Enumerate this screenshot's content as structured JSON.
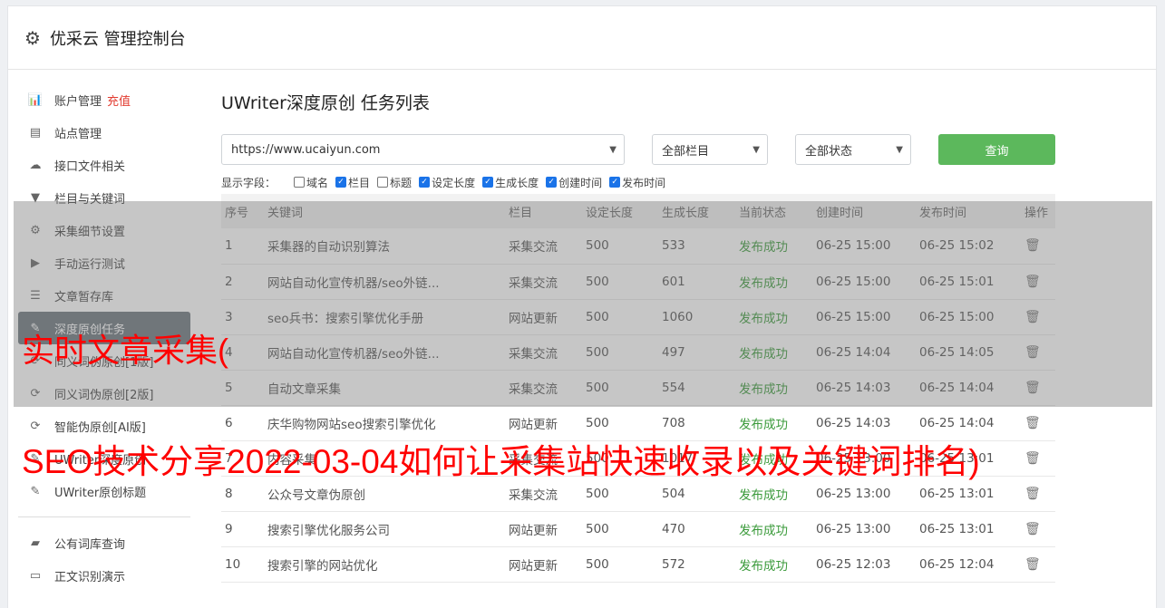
{
  "header": {
    "title": "优采云 管理控制台",
    "icon": "gear-icon"
  },
  "sidebar": {
    "items": [
      {
        "label": "账户管理",
        "badge": "充值",
        "icon": "bar-chart-icon",
        "glyph": "📊"
      },
      {
        "label": "站点管理",
        "icon": "server-icon",
        "glyph": "▤"
      },
      {
        "label": "接口文件相关",
        "icon": "cloud-upload-icon",
        "glyph": "☁"
      },
      {
        "label": "栏目与关键词",
        "icon": "filter-icon",
        "glyph": "▼"
      },
      {
        "label": "采集细节设置",
        "icon": "cogs-icon",
        "glyph": "⚙"
      },
      {
        "label": "手动运行测试",
        "icon": "play-circle-icon",
        "glyph": "▶"
      },
      {
        "label": "文章暂存库",
        "icon": "database-icon",
        "glyph": "☰"
      },
      {
        "label": "深度原创任务",
        "icon": "edit-icon",
        "glyph": "✎",
        "active": true
      },
      {
        "label": "同义词伪原创[1版]",
        "icon": "refresh-icon",
        "glyph": "⟳"
      },
      {
        "label": "同义词伪原创[2版]",
        "icon": "refresh-icon",
        "glyph": "⟳"
      },
      {
        "label": "智能伪原创[AI版]",
        "icon": "refresh-icon",
        "glyph": "⟳"
      },
      {
        "label": "UWriter深度原创",
        "icon": "edit-icon",
        "glyph": "✎"
      },
      {
        "label": "UWriter原创标题",
        "icon": "edit-icon",
        "glyph": "✎"
      }
    ],
    "items2": [
      {
        "label": "公有词库查询",
        "icon": "book-icon",
        "glyph": "▰"
      },
      {
        "label": "正文识别演示",
        "icon": "desktop-icon",
        "glyph": "▭"
      }
    ]
  },
  "main": {
    "title": "UWriter深度原创 任务列表",
    "site_select": "https://www.ucaiyun.com",
    "category_select": "全部栏目",
    "status_select": "全部状态",
    "query_label": "查询",
    "fields_label": "显示字段：",
    "fields": [
      {
        "label": "域名",
        "checked": false
      },
      {
        "label": "栏目",
        "checked": true
      },
      {
        "label": "标题",
        "checked": false
      },
      {
        "label": "设定长度",
        "checked": true
      },
      {
        "label": "生成长度",
        "checked": true
      },
      {
        "label": "创建时间",
        "checked": true
      },
      {
        "label": "发布时间",
        "checked": true
      }
    ],
    "columns": [
      "序号",
      "关键词",
      "栏目",
      "设定长度",
      "生成长度",
      "当前状态",
      "创建时间",
      "发布时间",
      "操作"
    ],
    "rows": [
      [
        "1",
        "采集器的自动识别算法",
        "采集交流",
        "500",
        "533",
        "发布成功",
        "06-25 15:00",
        "06-25 15:02"
      ],
      [
        "2",
        "网站自动化宣传机器/seo外链...",
        "采集交流",
        "500",
        "601",
        "发布成功",
        "06-25 15:00",
        "06-25 15:01"
      ],
      [
        "3",
        "seo兵书：搜索引擎优化手册",
        "网站更新",
        "500",
        "1060",
        "发布成功",
        "06-25 15:00",
        "06-25 15:00"
      ],
      [
        "4",
        "网站自动化宣传机器/seo外链...",
        "采集交流",
        "500",
        "497",
        "发布成功",
        "06-25 14:04",
        "06-25 14:05"
      ],
      [
        "5",
        "自动文章采集",
        "采集交流",
        "500",
        "554",
        "发布成功",
        "06-25 14:03",
        "06-25 14:04"
      ],
      [
        "6",
        "庆华购物网站seo搜索引擎优化",
        "网站更新",
        "500",
        "708",
        "发布成功",
        "06-25 14:03",
        "06-25 14:04"
      ],
      [
        "7",
        "内容采集",
        "采集交流",
        "500",
        "1017",
        "发布成功",
        "06-25 13:00",
        "06-25 13:01"
      ],
      [
        "8",
        "公众号文章伪原创",
        "采集交流",
        "500",
        "504",
        "发布成功",
        "06-25 13:00",
        "06-25 13:01"
      ],
      [
        "9",
        "搜索引擎优化服务公司",
        "网站更新",
        "500",
        "470",
        "发布成功",
        "06-25 13:00",
        "06-25 13:01"
      ],
      [
        "10",
        "搜索引擎的网站优化",
        "网站更新",
        "500",
        "572",
        "发布成功",
        "06-25 12:03",
        "06-25 12:04"
      ]
    ]
  },
  "captions": {
    "line1": "实时文章采集(",
    "line2": "SEO技术分享2022-03-04如何让采集站快速收录以及关键词排名)",
    "color": "#ff0000"
  },
  "colors": {
    "success": "#3a9a3a",
    "query_button": "#5cb85c",
    "active_item": "#6c757d",
    "badge": "#e23b30"
  }
}
